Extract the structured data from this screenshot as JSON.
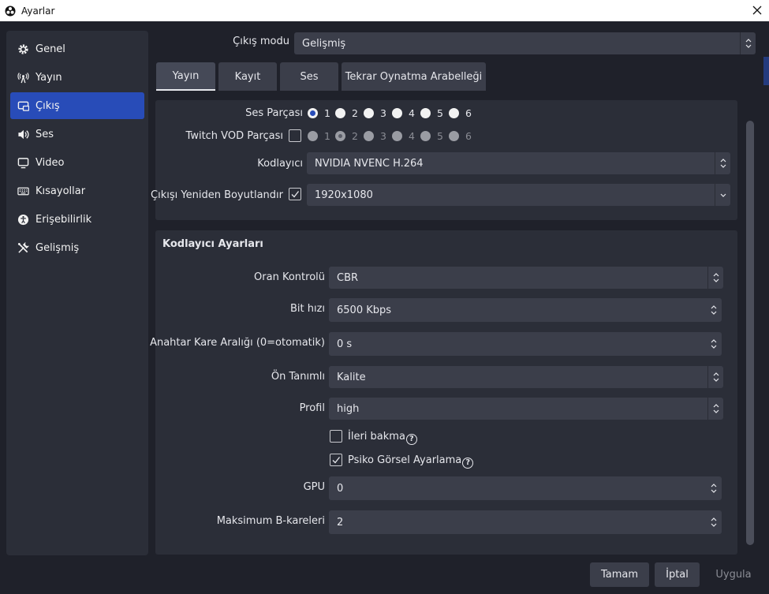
{
  "window": {
    "title": "Ayarlar"
  },
  "sidebar": {
    "items": [
      {
        "label": "Genel",
        "icon": "gear-icon"
      },
      {
        "label": "Yayın",
        "icon": "broadcast-icon"
      },
      {
        "label": "Çıkış",
        "icon": "output-icon",
        "active": true
      },
      {
        "label": "Ses",
        "icon": "speaker-icon"
      },
      {
        "label": "Video",
        "icon": "monitor-icon"
      },
      {
        "label": "Kısayollar",
        "icon": "keyboard-icon"
      },
      {
        "label": "Erişebilirlik",
        "icon": "accessibility-icon"
      },
      {
        "label": "Gelişmiş",
        "icon": "tools-icon"
      }
    ]
  },
  "output_mode": {
    "label": "Çıkış modu",
    "value": "Gelişmiş"
  },
  "tabs": [
    {
      "label": "Yayın",
      "active": true
    },
    {
      "label": "Kayıt"
    },
    {
      "label": "Ses"
    },
    {
      "label": "Tekrar Oynatma Arabelleği"
    }
  ],
  "stream": {
    "audio_track": {
      "label": "Ses Parçası",
      "options": [
        "1",
        "2",
        "3",
        "4",
        "5",
        "6"
      ],
      "selected": "1"
    },
    "twitch_vod": {
      "label": "Twitch VOD Parçası",
      "enabled": false,
      "options": [
        "1",
        "2",
        "3",
        "4",
        "5",
        "6"
      ],
      "selected": "2"
    },
    "encoder": {
      "label": "Kodlayıcı",
      "value": "NVIDIA NVENC H.264"
    },
    "rescale": {
      "label": "Çıkışı Yeniden Boyutlandır",
      "checked": true,
      "value": "1920x1080"
    }
  },
  "encoder_settings": {
    "title": "Kodlayıcı Ayarları",
    "rate_control": {
      "label": "Oran Kontrolü",
      "value": "CBR"
    },
    "bitrate": {
      "label": "Bit hızı",
      "value": "6500 Kbps"
    },
    "keyframe": {
      "label": "Anahtar Kare Aralığı (0=otomatik)",
      "value": "0 s"
    },
    "preset": {
      "label": "Ön Tanımlı",
      "value": "Kalite"
    },
    "profile": {
      "label": "Profil",
      "value": "high"
    },
    "lookahead": {
      "label": "İleri bakma",
      "checked": false,
      "help": "?"
    },
    "psycho_visual": {
      "label": "Psiko Görsel Ayarlama",
      "checked": true,
      "help": "?"
    },
    "gpu": {
      "label": "GPU",
      "value": "0"
    },
    "max_bframes": {
      "label": "Maksimum B-kareleri",
      "value": "2"
    }
  },
  "buttons": {
    "ok": "Tamam",
    "cancel": "İptal",
    "apply": "Uygula"
  },
  "colors": {
    "accent": "#284cb8",
    "background": "#1f212a",
    "panel": "#2b2e38",
    "control": "#3b3e4a"
  }
}
